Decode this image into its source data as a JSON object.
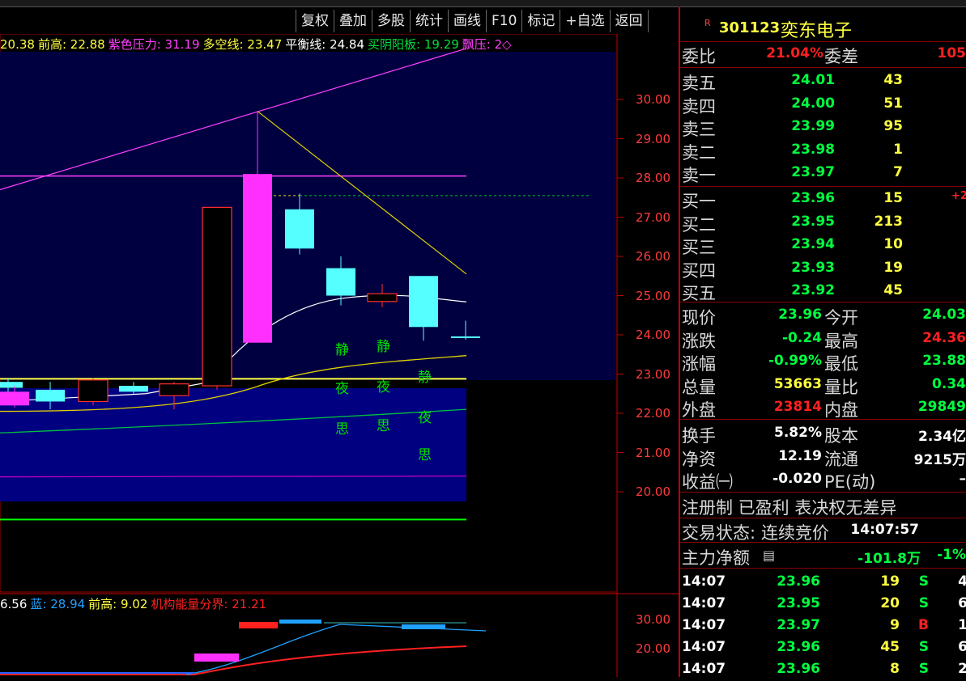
{
  "toolbar": [
    "复权",
    "叠加",
    "多股",
    "统计",
    "画线",
    "F10",
    "标记",
    "+自选",
    "返回"
  ],
  "indicator_header": [
    {
      "text": "20.38",
      "color": "#ffff40"
    },
    {
      "text": "前高: 22.88",
      "color": "#ffff40"
    },
    {
      "text": "紫色压力: 31.19",
      "color": "#ff40ff"
    },
    {
      "text": "多空线: 23.47",
      "color": "#ffff40"
    },
    {
      "text": "平衡线: 24.84",
      "color": "#ffffff"
    },
    {
      "text": "买阴阳板: 19.29",
      "color": "#00e040"
    },
    {
      "text": "飘压: 2◇",
      "color": "#ff40ff"
    }
  ],
  "sub_header": [
    {
      "text": "6.56",
      "color": "#ffffff"
    },
    {
      "text": "蓝: 28.94",
      "color": "#20a0ff"
    },
    {
      "text": "前高: 9.02",
      "color": "#ffff40"
    },
    {
      "text": "机构能量分界: 21.21",
      "color": "#ff2020"
    }
  ],
  "chart_data": {
    "type": "candlestick",
    "price_axis_ticks": [
      "30.00",
      "29.00",
      "28.00",
      "27.00",
      "26.00",
      "25.00",
      "24.00",
      "23.00",
      "22.00",
      "21.00",
      "20.00"
    ],
    "sub_axis_ticks": [
      "30.00",
      "20.00"
    ],
    "candles": [
      {
        "open": 22.65,
        "close": 22.8,
        "high": 22.9,
        "low": 22.4,
        "color": "cyan"
      },
      {
        "open": 22.55,
        "close": 22.2,
        "high": 22.7,
        "low": 22.15,
        "color": "magenta"
      },
      {
        "open": 22.3,
        "close": 22.6,
        "high": 22.8,
        "low": 22.1,
        "color": "cyan"
      },
      {
        "open": 22.85,
        "close": 22.3,
        "high": 22.9,
        "low": 22.2,
        "color": "red"
      },
      {
        "open": 22.55,
        "close": 22.7,
        "high": 22.8,
        "low": 22.5,
        "color": "cyan"
      },
      {
        "open": 22.75,
        "close": 22.45,
        "high": 22.8,
        "low": 22.1,
        "color": "red"
      },
      {
        "open": 22.7,
        "close": 27.25,
        "high": 27.25,
        "low": 22.6,
        "color": "red"
      },
      {
        "open": 28.1,
        "close": 23.8,
        "high": 29.7,
        "low": 23.8,
        "color": "magenta"
      },
      {
        "open": 26.2,
        "close": 27.2,
        "high": 27.6,
        "low": 26.05,
        "color": "cyan"
      },
      {
        "open": 25.0,
        "close": 25.7,
        "high": 26.0,
        "low": 24.75,
        "color": "cyan"
      },
      {
        "open": 25.05,
        "close": 24.85,
        "high": 25.3,
        "low": 24.7,
        "color": "red"
      },
      {
        "open": 24.2,
        "close": 25.5,
        "high": 25.5,
        "low": 23.85,
        "color": "cyan"
      },
      {
        "open": 23.96,
        "close": 23.96,
        "high": 24.36,
        "low": 23.88,
        "color": "cyan"
      }
    ],
    "markers": [
      {
        "text": "静",
        "candle": 9
      },
      {
        "text": "夜",
        "candle": 9
      },
      {
        "text": "思",
        "candle": 9
      },
      {
        "text": "静",
        "candle": 10
      },
      {
        "text": "夜",
        "candle": 10
      },
      {
        "text": "思",
        "candle": 10
      },
      {
        "text": "静",
        "candle": 11
      },
      {
        "text": "夜",
        "candle": 11
      },
      {
        "text": "思",
        "candle": 11
      }
    ]
  },
  "panel": {
    "badge": "R",
    "code": "301123",
    "name": "奕东电子",
    "weibi": {
      "label": "委比",
      "value": "21.04%",
      "label2": "委差",
      "value2": "105"
    },
    "sells": [
      {
        "label": "卖五",
        "price": "24.01",
        "vol": "43"
      },
      {
        "label": "卖四",
        "price": "24.00",
        "vol": "51"
      },
      {
        "label": "卖三",
        "price": "23.99",
        "vol": "95"
      },
      {
        "label": "卖二",
        "price": "23.98",
        "vol": "1"
      },
      {
        "label": "卖一",
        "price": "23.97",
        "vol": "7"
      }
    ],
    "buys": [
      {
        "label": "买一",
        "price": "23.96",
        "vol": "15",
        "extra": "+2"
      },
      {
        "label": "买二",
        "price": "23.95",
        "vol": "213",
        "extra": ""
      },
      {
        "label": "买三",
        "price": "23.94",
        "vol": "10",
        "extra": ""
      },
      {
        "label": "买四",
        "price": "23.93",
        "vol": "19",
        "extra": ""
      },
      {
        "label": "买五",
        "price": "23.92",
        "vol": "45",
        "extra": ""
      }
    ],
    "stats1": [
      {
        "l1": "现价",
        "v1": "23.96",
        "c1": "green",
        "l2": "今开",
        "v2": "24.03",
        "c2": "green"
      },
      {
        "l1": "涨跌",
        "v1": "-0.24",
        "c1": "green",
        "l2": "最高",
        "v2": "24.36",
        "c2": "red"
      },
      {
        "l1": "涨幅",
        "v1": "-0.99%",
        "c1": "green",
        "l2": "最低",
        "v2": "23.88",
        "c2": "green"
      },
      {
        "l1": "总量",
        "v1": "53663",
        "c1": "yellow",
        "l2": "量比",
        "v2": "0.34",
        "c2": "green"
      },
      {
        "l1": "外盘",
        "v1": "23814",
        "c1": "red",
        "l2": "内盘",
        "v2": "29849",
        "c2": "green"
      }
    ],
    "stats2": [
      {
        "l1": "换手",
        "v1": "5.82%",
        "l2": "股本",
        "v2": "2.34亿"
      },
      {
        "l1": "净资",
        "v1": "12.19",
        "l2": "流通",
        "v2": "9215万"
      },
      {
        "l1": "收益㈠",
        "v1": "-0.020",
        "l2": "PE(动)",
        "v2": "–"
      }
    ],
    "info1": "注册制 已盈利 表决权无差异",
    "status_label": "交易状态:",
    "status_value": "连续竞价",
    "status_time": "14:07:57",
    "netflow_label": "主力净额",
    "netflow_value": "-101.8万",
    "netflow_pct": "-1%",
    "ticks": [
      {
        "time": "14:07",
        "price": "23.96",
        "vol": "19",
        "side": "S",
        "n": "4"
      },
      {
        "time": "14:07",
        "price": "23.95",
        "vol": "20",
        "side": "S",
        "n": "6"
      },
      {
        "time": "14:07",
        "price": "23.97",
        "vol": "9",
        "side": "B",
        "n": "1"
      },
      {
        "time": "14:07",
        "price": "23.96",
        "vol": "45",
        "side": "S",
        "n": "6"
      },
      {
        "time": "14:07",
        "price": "23.96",
        "vol": "8",
        "side": "S",
        "n": "2"
      }
    ]
  }
}
